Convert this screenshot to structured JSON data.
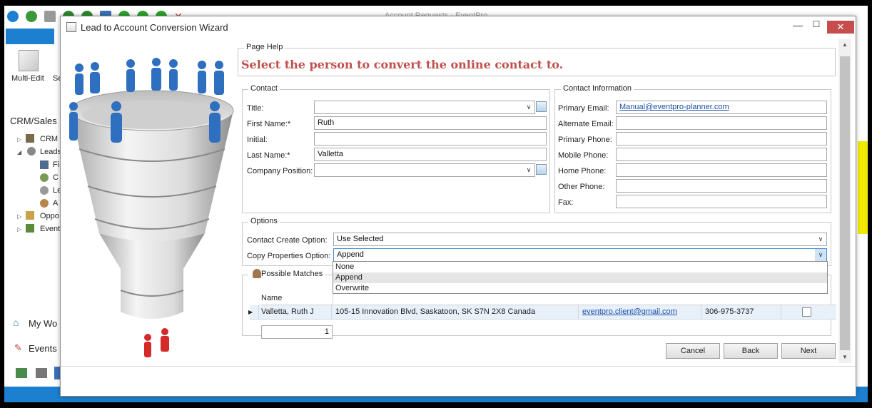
{
  "background_app": {
    "window_title": "Account Requests - EventPro",
    "ribbon": {
      "multi_edit_label": "Multi-Edit",
      "partial_label": "Se"
    },
    "sidebar": {
      "title": "CRM/Sales",
      "items": [
        {
          "label": "CRM",
          "level": 1
        },
        {
          "label": "Leads",
          "level": 1
        },
        {
          "label": "Fi",
          "level": 2
        },
        {
          "label": "C",
          "level": 2
        },
        {
          "label": "Le",
          "level": 2
        },
        {
          "label": "A",
          "level": 2
        },
        {
          "label": "Oppo",
          "level": 1
        },
        {
          "label": "Event",
          "level": 1
        }
      ],
      "bottom_nav": [
        {
          "label": "My Wo"
        },
        {
          "label": "Events"
        }
      ]
    },
    "colors": {
      "accent": "#1d7fd0",
      "highlight": "#f2e900"
    }
  },
  "dialog": {
    "title": "Lead to Account Conversion Wizard",
    "controls": {
      "minimize": "—",
      "maximize": "☐",
      "close": "✕"
    },
    "page_help": {
      "legend": "Page Help",
      "text": "Select the person to convert the online contact to."
    },
    "contact": {
      "legend": "Contact",
      "fields": {
        "title": {
          "label": "Title:",
          "value": ""
        },
        "first_name": {
          "label": "First Name:*",
          "value": "Ruth"
        },
        "initial": {
          "label": "Initial:",
          "value": ""
        },
        "last_name": {
          "label": "Last Name:*",
          "value": "Valletta"
        },
        "company_position": {
          "label": "Company Position:",
          "value": ""
        }
      }
    },
    "contact_information": {
      "legend": "Contact Information",
      "fields": {
        "primary_email": {
          "label": "Primary Email:",
          "value": "Manual@eventpro-planner.com"
        },
        "alternate_email": {
          "label": "Alternate Email:",
          "value": ""
        },
        "primary_phone": {
          "label": "Primary Phone:",
          "value": ""
        },
        "mobile_phone": {
          "label": "Mobile Phone:",
          "value": ""
        },
        "home_phone": {
          "label": "Home Phone:",
          "value": ""
        },
        "other_phone": {
          "label": "Other Phone:",
          "value": ""
        },
        "fax": {
          "label": "Fax:",
          "value": ""
        }
      }
    },
    "options": {
      "legend": "Options",
      "contact_create": {
        "label": "Contact Create Option:",
        "value": "Use Selected"
      },
      "copy_properties": {
        "label": "Copy Properties Option:",
        "value": "Append",
        "dropdown_open": true,
        "dropdown_items": [
          "None",
          "Append",
          "Overwrite"
        ],
        "highlighted_index": 1
      }
    },
    "possible_matches": {
      "legend": "Possible Matches",
      "columns": [
        "Name"
      ],
      "rows": [
        {
          "name": "Valletta, Ruth J",
          "address": "105-15 Innovation Blvd, Saskatoon, SK S7N 2X8 Canada",
          "email": "eventpro.client@gmail.com",
          "phone": "306-975-3737",
          "selected": false
        }
      ],
      "record_count": "1"
    },
    "buttons": {
      "cancel": "Cancel",
      "back": "Back",
      "next": "Next"
    },
    "colors": {
      "help_text": "#c0504d",
      "close_button": "#c74c4c",
      "selected_row": "#e8f0fa"
    }
  }
}
